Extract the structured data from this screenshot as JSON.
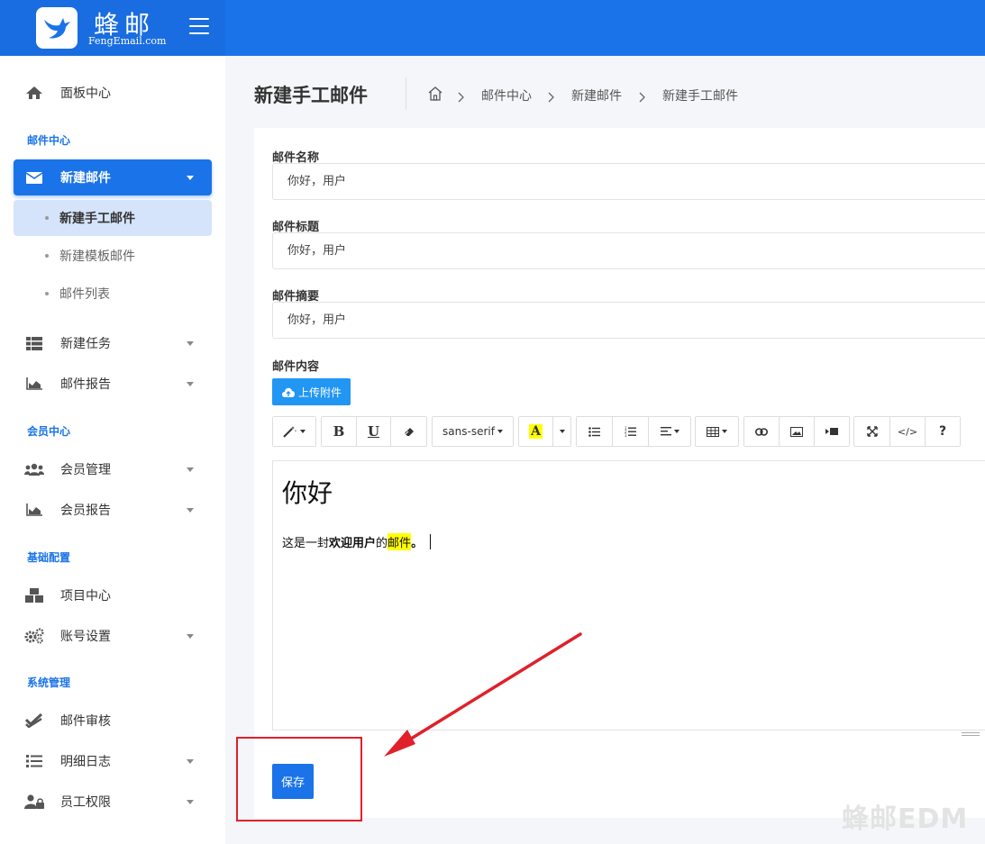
{
  "brand": {
    "name": "蜂邮",
    "sub": "FengEmail.com"
  },
  "sidebar": {
    "dashboard": "面板中心",
    "sections": {
      "mail": "邮件中心",
      "member": "会员中心",
      "config": "基础配置",
      "system": "系统管理"
    },
    "items": {
      "new_mail": "新建邮件",
      "new_manual_mail": "新建手工邮件",
      "new_template_mail": "新建模板邮件",
      "mail_list": "邮件列表",
      "new_task": "新建任务",
      "mail_report": "邮件报告",
      "member_manage": "会员管理",
      "member_report": "会员报告",
      "project_center": "项目中心",
      "account_settings": "账号设置",
      "mail_review": "邮件审核",
      "detail_log": "明细日志",
      "staff_permission": "员工权限"
    }
  },
  "page": {
    "title": "新建手工邮件",
    "breadcrumb": [
      "邮件中心",
      "新建邮件",
      "新建手工邮件"
    ]
  },
  "form": {
    "name_label": "邮件名称",
    "name_value": "你好，用户",
    "subject_label": "邮件标题",
    "subject_value": "你好，用户",
    "summary_label": "邮件摘要",
    "summary_value": "你好，用户",
    "content_label": "邮件内容",
    "upload_label": "上传附件",
    "save_label": "保存"
  },
  "toolbar": {
    "bold": "B",
    "underline": "U",
    "font_family": "sans-serif",
    "font_color": "A",
    "codeview": "</>",
    "help": "?"
  },
  "editor": {
    "heading": "你好",
    "text_plain": "这是一封",
    "text_bold": "欢迎用户",
    "text_mid": "的",
    "text_highlight": "邮件",
    "text_end": "。"
  },
  "watermark": "蜂邮EDM",
  "colors": {
    "primary": "#1a73e8",
    "upload": "#2196f3",
    "annotation": "#e0202a",
    "highlight": "#ffff00"
  }
}
